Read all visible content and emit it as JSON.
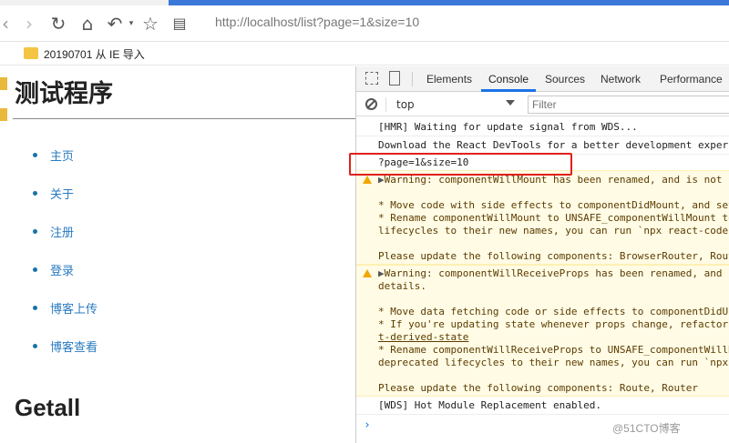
{
  "browser": {
    "url": "http://localhost/list?page=1&size=10",
    "bookmark_folder": "20190701 从 IE 导入"
  },
  "page": {
    "title": "测试程序",
    "nav": [
      "主页",
      "关于",
      "注册",
      "登录",
      "博客上传",
      "博客查看"
    ],
    "section_title": "Getall"
  },
  "devtools": {
    "tabs": [
      "Elements",
      "Console",
      "Sources",
      "Network",
      "Performance"
    ],
    "active_tab": "Console",
    "context": "top",
    "filter_placeholder": "Filter",
    "console": {
      "l1": "[HMR] Waiting for update signal from WDS...",
      "l2": "Download the React DevTools for a better development experi",
      "l3": "?page=1&size=10",
      "w1_l1": "Warning: componentWillMount has been renamed, and is not",
      "w1_l2": "* Move code with side effects to componentDidMount, and set",
      "w1_l3": "* Rename componentWillMount to UNSAFE_componentWillMount to",
      "w1_l4": "lifecycles to their new names, you can run `npx react-coder",
      "w1_l5": "Please update the following components: BrowserRouter, Rout",
      "w2_l1": "Warning: componentWillReceiveProps has been renamed, and",
      "w2_l2": "details.",
      "w2_l3": "* Move data fetching code or side effects to componentDidUp",
      "w2_l4": "* If you're updating state whenever props change, refactor",
      "w2_l5": "t-derived-state",
      "w2_l6": "* Rename componentWillReceiveProps to UNSAFE_componentWillR",
      "w2_l7": "deprecated lifecycles to their new names, you can run `npx",
      "w2_l8": "Please update the following components: Route, Router",
      "l4": "[WDS] Hot Module Replacement enabled.",
      "prompt": "›"
    }
  },
  "watermark": "@51CTO博客",
  "colors": {
    "accent": "#1a73e8",
    "highlight": "#e0201b",
    "warning_bg": "#fffbe5"
  }
}
